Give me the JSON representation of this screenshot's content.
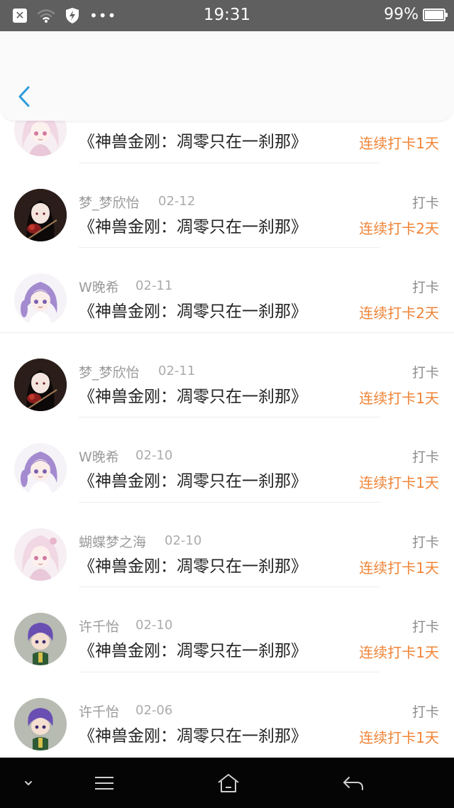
{
  "status_bar": {
    "time": "19:31",
    "battery": "99%",
    "battery_level": 0.99,
    "icons": [
      "close-notification-icon",
      "wifi-icon",
      "shield-icon",
      "more-dots-icon",
      "battery-icon"
    ]
  },
  "header": {
    "back_icon": "chevron-left-icon"
  },
  "colors": {
    "accent_blue": "#2d9bdc",
    "streak_orange": "#f08437",
    "name_gray": "#9a9a9a"
  },
  "records": [
    {
      "name": "",
      "date": "",
      "title": "《神兽金刚：凋零只在一刹那》",
      "kind": "",
      "streak": "连续打卡1天",
      "avatar": "pink-girl"
    },
    {
      "name": "梦_梦欣怡",
      "date": "02-12",
      "title": "《神兽金刚：凋零只在一刹那》",
      "kind": "打卡",
      "streak": "连续打卡2天",
      "avatar": "violin-girl"
    },
    {
      "name": "W晚希",
      "date": "02-11",
      "title": "《神兽金刚：凋零只在一刹那》",
      "kind": "打卡",
      "streak": "连续打卡2天",
      "avatar": "purple-girl"
    },
    {
      "name": "梦_梦欣怡",
      "date": "02-11",
      "title": "《神兽金刚：凋零只在一刹那》",
      "kind": "打卡",
      "streak": "连续打卡1天",
      "avatar": "violin-girl"
    },
    {
      "name": "W晚希",
      "date": "02-10",
      "title": "《神兽金刚：凋零只在一刹那》",
      "kind": "打卡",
      "streak": "连续打卡1天",
      "avatar": "purple-girl"
    },
    {
      "name": "蝴蝶梦之海",
      "date": "02-10",
      "title": "《神兽金刚：凋零只在一刹那》",
      "kind": "打卡",
      "streak": "连续打卡1天",
      "avatar": "pink-girl"
    },
    {
      "name": "许千怡",
      "date": "02-10",
      "title": "《神兽金刚：凋零只在一刹那》",
      "kind": "打卡",
      "streak": "连续打卡1天",
      "avatar": "chibi-boy"
    },
    {
      "name": "许千怡",
      "date": "02-06",
      "title": "《神兽金刚：凋零只在一刹那》",
      "kind": "打卡",
      "streak": "连续打卡1天",
      "avatar": "chibi-boy"
    }
  ],
  "nav_bar": {
    "icons": [
      "chevron-down-icon",
      "menu-icon",
      "home-icon",
      "back-arrow-icon"
    ]
  }
}
